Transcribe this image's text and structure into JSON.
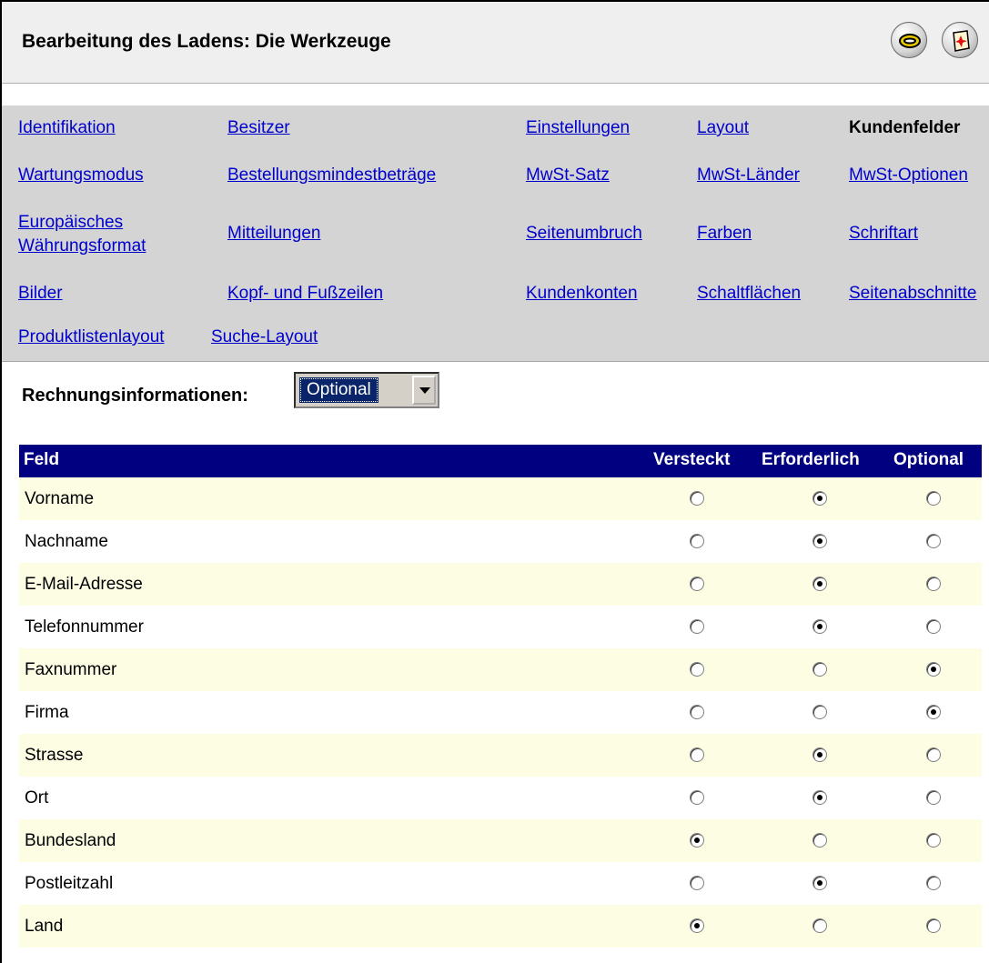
{
  "header": {
    "title": "Bearbeitung des Ladens: Die Werkzeuge",
    "icons": [
      "link-icon",
      "help-icon"
    ]
  },
  "nav": {
    "items": [
      "Identifikation",
      "Besitzer",
      "Einstellungen",
      "Layout",
      "Kundenfelder",
      "Wartungsmodus",
      "Bestellungsmindestbeträge",
      "MwSt-Satz",
      "MwSt-Länder",
      "MwSt-Optionen",
      "Europäisches Währungsformat",
      "Mitteilungen",
      "Seitenumbruch",
      "Farben",
      "Schriftart",
      "Bilder",
      "Kopf- und Fußzeilen",
      "Kundenkonten",
      "Schaltflächen",
      "Seitenabschnitte",
      "Produktlistenlayout",
      "Suche-Layout"
    ],
    "active": "Kundenfelder"
  },
  "billing": {
    "label": "Rechnungsinformationen:",
    "selected": "Optional"
  },
  "table": {
    "headers": {
      "field": "Feld",
      "hidden": "Versteckt",
      "required": "Erforderlich",
      "optional": "Optional"
    },
    "rows": [
      {
        "label": "Vorname",
        "selected": "required"
      },
      {
        "label": "Nachname",
        "selected": "required"
      },
      {
        "label": "E-Mail-Adresse",
        "selected": "required"
      },
      {
        "label": "Telefonnummer",
        "selected": "required"
      },
      {
        "label": "Faxnummer",
        "selected": "optional"
      },
      {
        "label": "Firma",
        "selected": "optional"
      },
      {
        "label": "Strasse",
        "selected": "required"
      },
      {
        "label": "Ort",
        "selected": "required"
      },
      {
        "label": "Bundesland",
        "selected": "hidden"
      },
      {
        "label": "Postleitzahl",
        "selected": "required"
      },
      {
        "label": "Land",
        "selected": "hidden"
      }
    ]
  },
  "colors": {
    "header_bg": "#000080",
    "row_alt": "#fdfde4",
    "nav_bg": "#d4d4d4",
    "link": "#0000cc"
  }
}
